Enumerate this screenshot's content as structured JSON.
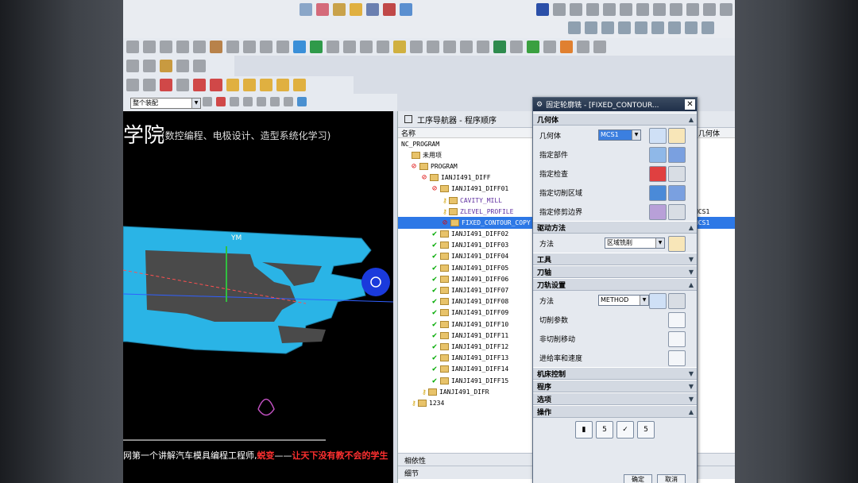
{
  "toolbar": {
    "combo_value": "整个装配"
  },
  "viewport": {
    "title": "学院",
    "subtitle": "(数控编程、电极设计、造型系统化学习)",
    "bottom_prefix": "网第一个讲解汽车模具编程工程师,",
    "bottom_red": "蜕变",
    "bottom_dash": "——",
    "bottom_red2": "让天下没有教不会的学生",
    "axis_label": "YM"
  },
  "navigator": {
    "title": "工序导航器 - 程序顺序",
    "col_name": "名称",
    "col_geom": "几何体",
    "rows": [
      {
        "text": "NC_PROGRAM",
        "indent": 0,
        "mark": ""
      },
      {
        "text": "未用项",
        "indent": 1,
        "mark": "fold"
      },
      {
        "text": "PROGRAM",
        "indent": 1,
        "mark": "no"
      },
      {
        "text": "IANJI491_DIFF",
        "indent": 2,
        "mark": "no"
      },
      {
        "text": "IANJI491_DIFF01",
        "indent": 3,
        "mark": "no"
      },
      {
        "text": "CAVITY_MILL",
        "indent": 4,
        "mark": "key",
        "geo": ""
      },
      {
        "text": "ZLEVEL_PROFILE",
        "indent": 4,
        "mark": "key",
        "geo": "MCS1"
      },
      {
        "text": "FIXED_CONTOUR_COPY",
        "indent": 4,
        "mark": "no",
        "geo": "MCS1",
        "selected": true
      },
      {
        "text": "IANJI491_DIFF02",
        "indent": 3,
        "mark": "chk"
      },
      {
        "text": "IANJI491_DIFF03",
        "indent": 3,
        "mark": "chk"
      },
      {
        "text": "IANJI491_DIFF04",
        "indent": 3,
        "mark": "chk"
      },
      {
        "text": "IANJI491_DIFF05",
        "indent": 3,
        "mark": "chk"
      },
      {
        "text": "IANJI491_DIFF06",
        "indent": 3,
        "mark": "chk"
      },
      {
        "text": "IANJI491_DIFF07",
        "indent": 3,
        "mark": "chk"
      },
      {
        "text": "IANJI491_DIFF08",
        "indent": 3,
        "mark": "chk"
      },
      {
        "text": "IANJI491_DIFF09",
        "indent": 3,
        "mark": "chk"
      },
      {
        "text": "IANJI491_DIFF10",
        "indent": 3,
        "mark": "chk"
      },
      {
        "text": "IANJI491_DIFF11",
        "indent": 3,
        "mark": "chk"
      },
      {
        "text": "IANJI491_DIFF12",
        "indent": 3,
        "mark": "chk"
      },
      {
        "text": "IANJI491_DIFF13",
        "indent": 3,
        "mark": "chk"
      },
      {
        "text": "IANJI491_DIFF14",
        "indent": 3,
        "mark": "chk"
      },
      {
        "text": "IANJI491_DIFF15",
        "indent": 3,
        "mark": "chk"
      },
      {
        "text": "IANJI491_DIFR",
        "indent": 2,
        "mark": "key"
      },
      {
        "text": "1234",
        "indent": 1,
        "mark": "key"
      }
    ],
    "bottom1": "相依性",
    "bottom2": "细节"
  },
  "dialog": {
    "title": "固定轮廓铣 - [FIXED_CONTOUR...",
    "sec_geometry": "几何体",
    "geometry_label": "几何体",
    "geometry_value": "MCS1",
    "part_label": "指定部件",
    "check_label": "指定检查",
    "cut_area_label": "指定切削区域",
    "trim_label": "指定修剪边界",
    "sec_drive": "驱动方法",
    "method_label": "方法",
    "drive_value": "区域铣削",
    "sec_tool": "工具",
    "sec_axis": "刀轴",
    "sec_path": "刀轨设置",
    "path_method_label": "方法",
    "path_method_value": "METHOD",
    "cut_params": "切削参数",
    "noncut": "非切削移动",
    "feeds": "进给率和速度",
    "sec_machine": "机床控制",
    "sec_program": "程序",
    "sec_options": "选项",
    "sec_actions": "操作",
    "ok": "确定",
    "cancel": "取消"
  }
}
